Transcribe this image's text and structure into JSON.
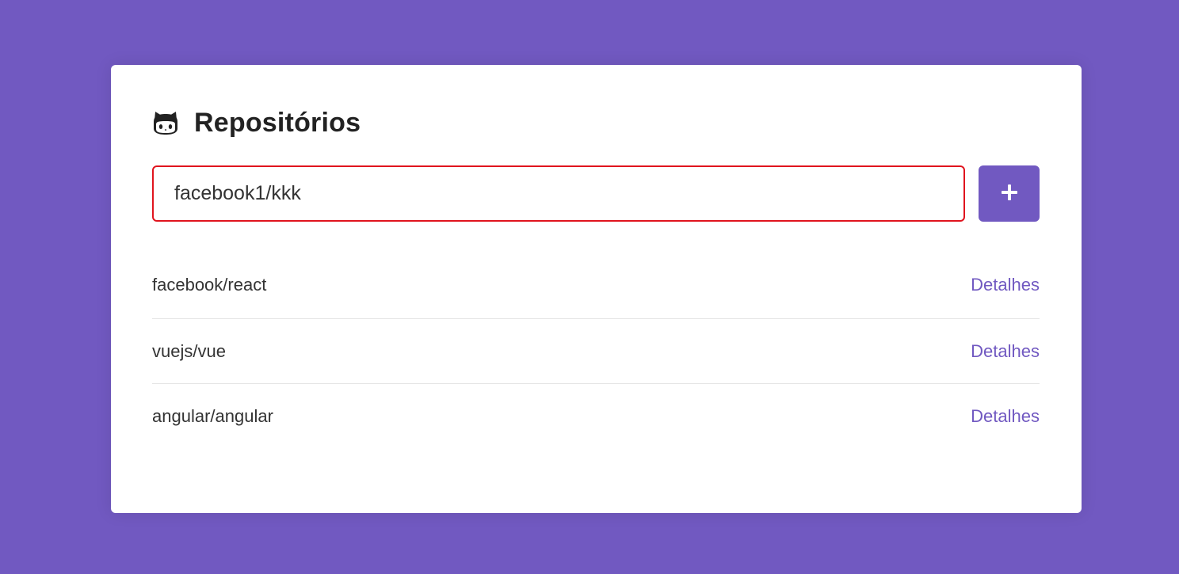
{
  "header": {
    "icon": "github-icon",
    "title": "Repositórios"
  },
  "form": {
    "input_value": "facebook1/kkk",
    "input_border_color": "#e0141e",
    "add_button_icon": "plus-icon"
  },
  "repositories": [
    {
      "name": "facebook/react",
      "link_label": "Detalhes"
    },
    {
      "name": "vuejs/vue",
      "link_label": "Detalhes"
    },
    {
      "name": "angular/angular",
      "link_label": "Detalhes"
    }
  ],
  "colors": {
    "background": "#7159c1",
    "accent": "#7159c1",
    "error": "#e0141e"
  }
}
